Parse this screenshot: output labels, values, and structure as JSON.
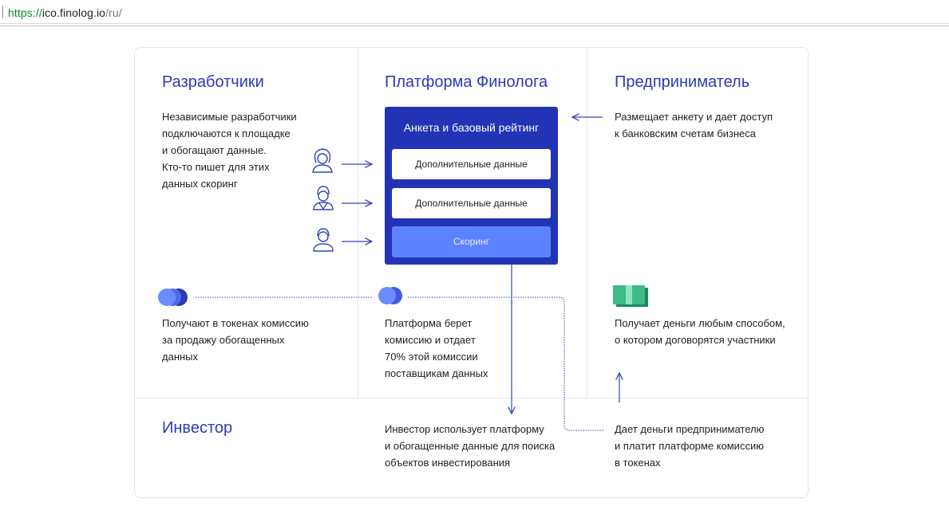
{
  "browser": {
    "url_scheme": "https://",
    "url_host": "ico.finolog.io",
    "url_path": "/ru/"
  },
  "columns": {
    "developers": {
      "title": "Разработчики",
      "description": "Независимые разработчики\nподключаются к площадке\nи обогащают данные.\nКто-то пишет для этих\nданных скоринг",
      "reward": "Получают в токенах комиссию\nза продажу обогащенных\nданных"
    },
    "platform": {
      "title": "Платформа Финолога",
      "box_title": "Анкета и базовый рейтинг",
      "items": [
        "Дополнительные данные",
        "Дополнительные данные"
      ],
      "scoring": "Скоринг",
      "commission": "Платформа берет\nкомиссию и отдает\n70% этой комиссии\nпоставщикам данных"
    },
    "entrepreneur": {
      "title": "Предприниматель",
      "description": "Размещает анкету и дает доступ\nк банковским счетам бизнеса",
      "money": "Получает деньги любым способом,\nо котором договорятся участники"
    }
  },
  "investor": {
    "title": "Инвестор",
    "usage": "Инвестор использует платформу\nи обогащенные данные для поиска\nобъектов инвестирования",
    "payment": "Дает деньги предпринимателю\nи платит платформе комиссию\nв токенах"
  },
  "colors": {
    "title_blue": "#2a3bb5",
    "box_blue": "#2234b5",
    "scoring_blue": "#5b83ff",
    "arrow_blue": "#3446b8",
    "money_green": "#3dbb8a"
  },
  "icons": [
    "woman-avatar-icon",
    "man-avatar-icon",
    "man-avatar-icon",
    "tokens-icon",
    "tokens-icon",
    "money-icon"
  ]
}
